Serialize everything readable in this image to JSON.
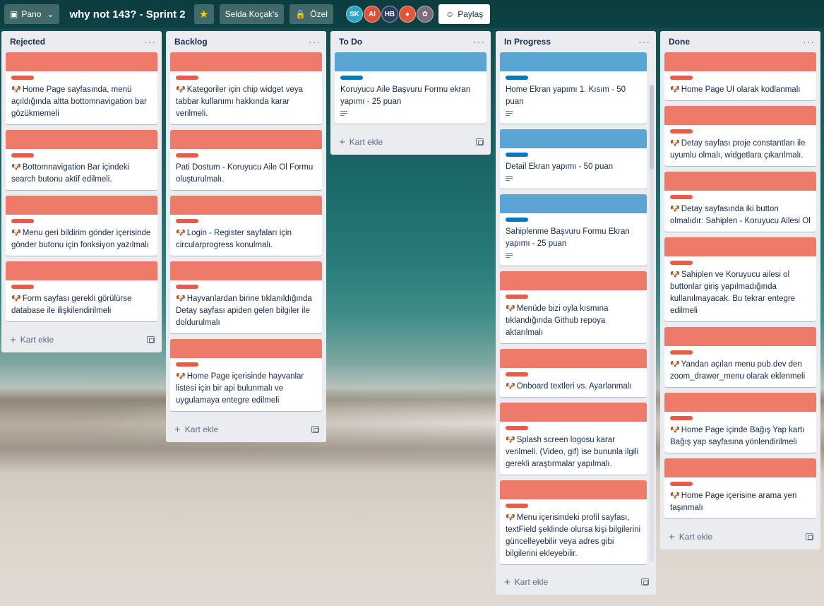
{
  "header": {
    "board_switch_label": "Pano",
    "board_title": "why not 143? - Sprint 2",
    "workspace_label": "Selda Koçak's",
    "visibility_label": "Özel",
    "share_label": "Paylaş",
    "members": [
      {
        "initials": "SK",
        "color": "#26a9c7"
      },
      {
        "initials": "AI",
        "color": "#e04e39"
      },
      {
        "initials": "HB",
        "color": "#2c3e66"
      },
      {
        "initials": "",
        "color": "#e0563b"
      },
      {
        "initials": "",
        "color": "#7b6d7f"
      }
    ]
  },
  "add_card_label": "Kart ekle",
  "lists": {
    "rejected": {
      "title": "Rejected",
      "cards": [
        "Home Page sayfasında, menü açıldığında altta bottomnavigation bar gözükmemeli",
        "Bottomnavigation Bar içindeki search butonu aktif edilmeli.",
        "Menu geri bildirim gönder içerisinde gönder butonu için fonksiyon yazılmalı",
        "Form sayfası gerekli görülürse database ile ilişkilendirilmeli"
      ]
    },
    "backlog": {
      "title": "Backlog",
      "cards": [
        "Kategoriler için chip widget veya tabbar kullanımı hakkında karar verilmeli.",
        "Pati Dostum - Koruyucu Aile Ol Formu oluşturulmalı.",
        "Login - Register sayfaları için circularprogress konulmalı.",
        "Hayvanlardan birine tıklanıldığında Detay sayfası apiden gelen bilgiler ile doldurulmalı",
        "Home Page içerisinde hayvanlar listesi için bir api bulunmalı ve uygulamaya entegre edilmeli"
      ]
    },
    "todo": {
      "title": "To Do",
      "cards": [
        "Koruyucu Aile Başvuru Formu ekran yapımı - 25 puan"
      ]
    },
    "inprogress": {
      "title": "In Progress",
      "cards": [
        "Home Ekran yapımı 1. Kısım - 50 puan",
        "Detail Ekran yapımı - 50 puan",
        "Sahiplenme Başvuru Formu Ekran yapımı - 25 puan",
        "Menüde bizi oyla kısmına tıklandığında Github repoya aktarılmalı",
        "Onboard textleri vs. Ayarlanmalı",
        "Splash screen logosu karar verilmeli. (Video, gif) ise bununla ilgili gerekli araştırmalar yapılmalı.",
        "Menu içerisindeki profil sayfası, textField şeklinde olursa kişi bilgilerini güncelleyebilir veya adres gibi bilgilerini ekleyebilir."
      ]
    },
    "done": {
      "title": "Done",
      "cards": [
        "Home Page UI olarak kodlanmalı",
        "Detay sayfası proje constantları ile uyumlu olmalı, widgetlara çıkarılmalı.",
        "Detay sayfasında iki button olmalıdır: Sahiplen - Koruyucu Ailesi Ol",
        "Sahiplen ve Koruyucu ailesi ol buttonlar giriş yapılmadığında kullanılmayacak. Bu tekrar entegre edilmeli",
        "Yandan açılan menu pub.dev den zoom_drawer_menu olarak eklenmeli",
        "Home Page içinde Bağış Yap kartı Bağış yap sayfasına yönlendirilmeli",
        "Home Page içerisine arama yeri taşınmalı"
      ]
    }
  }
}
